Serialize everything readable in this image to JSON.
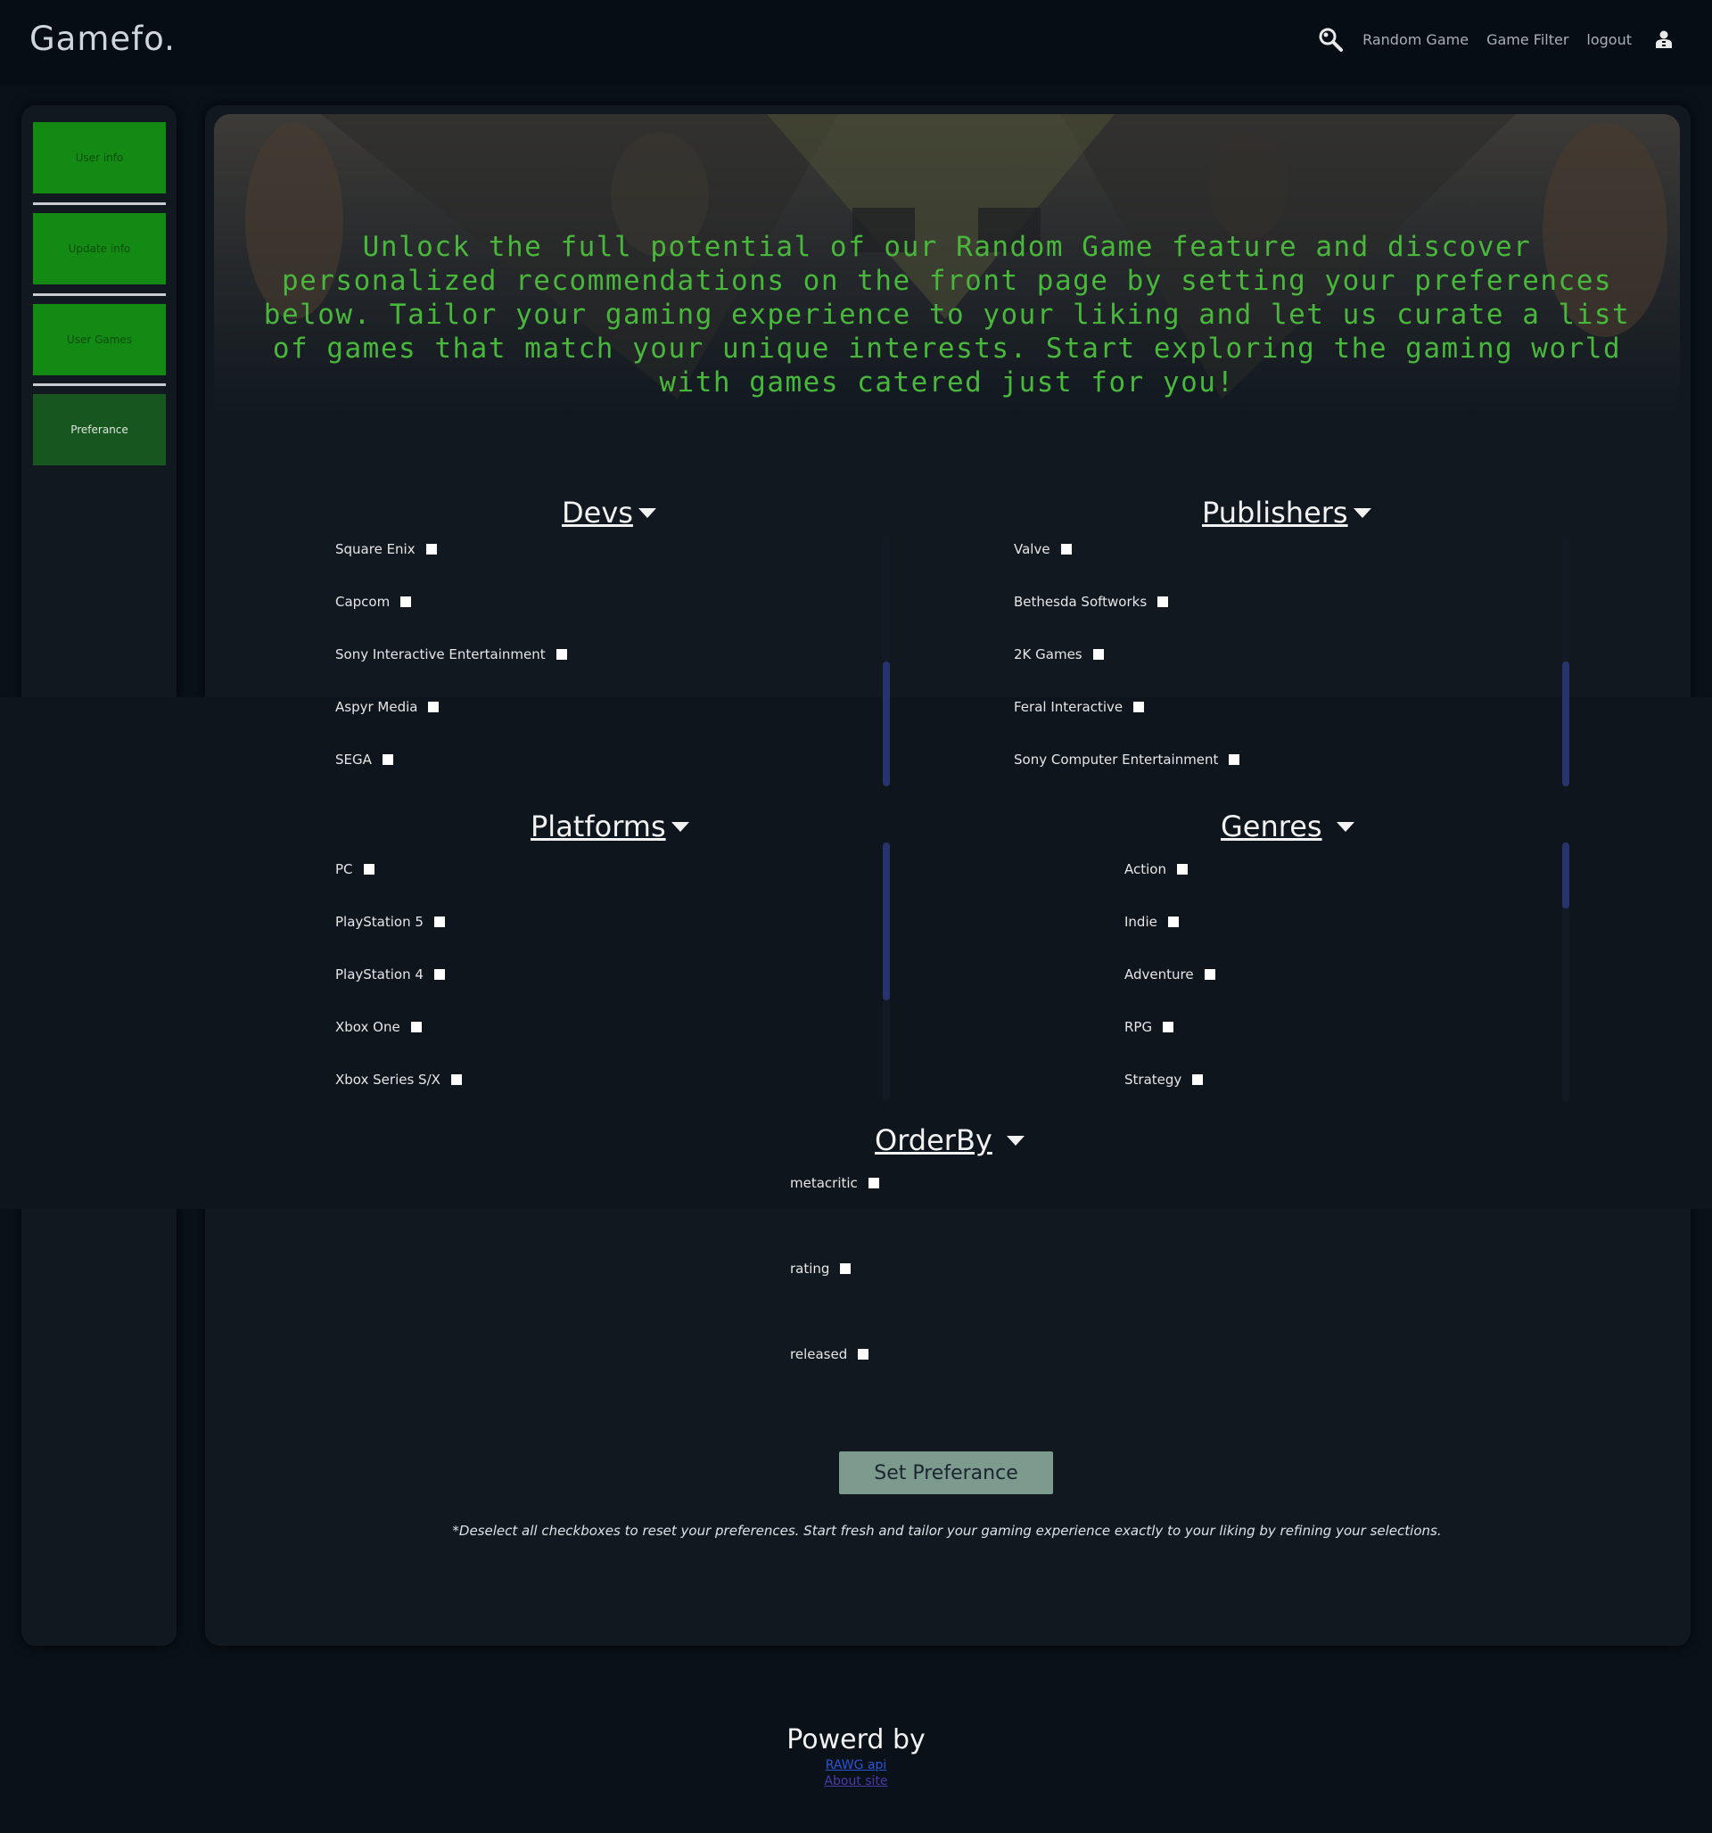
{
  "header": {
    "logo": "Gamefo.",
    "nav": [
      "Random Game",
      "Game Filter",
      "logout"
    ]
  },
  "sidebar": {
    "items": [
      "User info",
      "Update info",
      "User Games",
      "Preferance"
    ],
    "active": "Preferance"
  },
  "hero": {
    "text": "Unlock the full potential of our Random Game feature and discover personalized recommendations on the front page by setting your preferences below. Tailor your gaming experience to your liking and let us curate a list of games that match your unique interests. Start exploring the gaming world with games catered just for you!"
  },
  "sections": {
    "devs": {
      "title": "Devs",
      "options": [
        "Square Enix",
        "Capcom",
        "Sony Interactive Entertainment",
        "Aspyr Media",
        "SEGA"
      ]
    },
    "publishers": {
      "title": "Publishers",
      "options": [
        "Valve",
        "Bethesda Softworks",
        "2K Games",
        "Feral Interactive",
        "Sony Computer Entertainment"
      ]
    },
    "platforms": {
      "title": "Platforms",
      "options": [
        "PC",
        "PlayStation 5",
        "PlayStation 4",
        "Xbox One",
        "Xbox Series S/X"
      ]
    },
    "genres": {
      "title": "Genres",
      "options": [
        "Action",
        "Indie",
        "Adventure",
        "RPG",
        "Strategy"
      ]
    },
    "orderby": {
      "title": "OrderBy",
      "options": [
        "metacritic",
        "rating",
        "released"
      ]
    }
  },
  "actions": {
    "set_preference": "Set Preferance"
  },
  "note": "*Deselect all checkboxes to reset your preferences. Start fresh and tailor your gaming experience exactly to your liking by refining your selections.",
  "footer": {
    "title": "Powerd by",
    "links": [
      "RAWG api",
      "About site"
    ]
  },
  "colors": {
    "accent_green": "#49b63c",
    "sidebar_button": "#138a13",
    "sidebar_button_active": "#17571f",
    "link_blue": "#2a55d4",
    "link_visited": "#4a3aa8"
  }
}
